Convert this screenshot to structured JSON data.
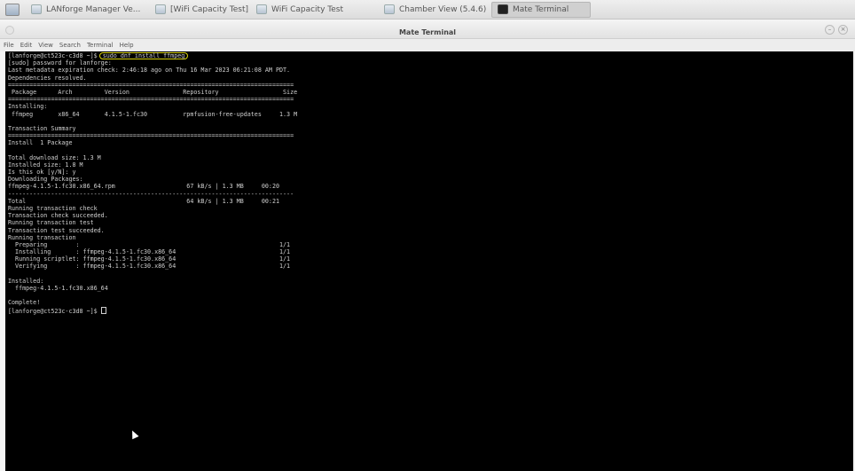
{
  "taskbar": {
    "tasks": [
      {
        "label": "LANforge Manager  Ve..."
      },
      {
        "label": "[WiFi Capacity Test]"
      },
      {
        "label": "WiFi Capacity Test"
      },
      {
        "label": "Chamber View (5.4.6)"
      },
      {
        "label": "Mate Terminal"
      }
    ]
  },
  "window": {
    "title": "Mate Terminal"
  },
  "menubar": {
    "items": [
      "File",
      "Edit",
      "View",
      "Search",
      "Terminal",
      "Help"
    ]
  },
  "terminal": {
    "prompt_first": "[lanforge@ct523c-c3d8 ~]$ ",
    "command": "sudo dnf install ffmpeg",
    "lines": [
      "[sudo] password for lanforge:",
      "Last metadata expiration check: 2:46:18 ago on Thu 16 Mar 2023 06:21:08 AM PDT.",
      "Dependencies resolved.",
      "================================================================================",
      " Package      Arch         Version               Repository                  Size",
      "================================================================================",
      "Installing:",
      " ffmpeg       x86_64       4.1.5-1.fc30          rpmfusion-free-updates     1.3 M",
      "",
      "Transaction Summary",
      "================================================================================",
      "Install  1 Package",
      "",
      "Total download size: 1.3 M",
      "Installed size: 1.8 M",
      "Is this ok [y/N]: y",
      "Downloading Packages:",
      "ffmpeg-4.1.5-1.fc30.x86_64.rpm                    67 kB/s | 1.3 MB     00:20",
      "--------------------------------------------------------------------------------",
      "Total                                             64 kB/s | 1.3 MB     00:21",
      "Running transaction check",
      "Transaction check succeeded.",
      "Running transaction test",
      "Transaction test succeeded.",
      "Running transaction",
      "  Preparing        :                                                        1/1",
      "  Installing       : ffmpeg-4.1.5-1.fc30.x86_64                             1/1",
      "  Running scriptlet: ffmpeg-4.1.5-1.fc30.x86_64                             1/1",
      "  Verifying        : ffmpeg-4.1.5-1.fc30.x86_64                             1/1",
      "",
      "Installed:",
      "  ffmpeg-4.1.5-1.fc30.x86_64",
      "",
      "Complete!"
    ],
    "prompt_last": "[lanforge@ct523c-c3d8 ~]$ "
  },
  "colors": {
    "terminal_bg": "#000000",
    "terminal_fg": "#cfcfcf",
    "highlight": "#d9d20a"
  }
}
